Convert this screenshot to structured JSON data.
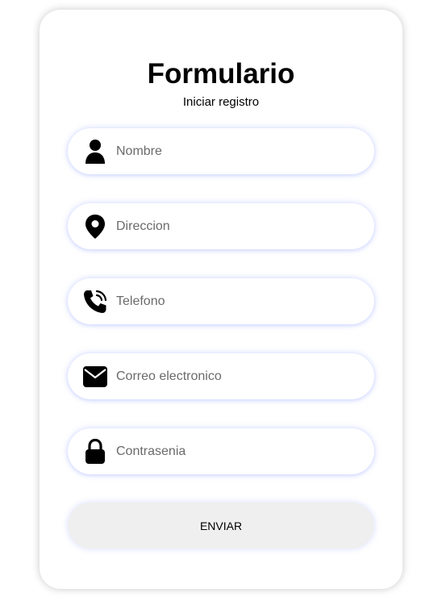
{
  "form": {
    "title": "Formulario",
    "subtitle": "Iniciar registro",
    "fields": [
      {
        "icon": "user-icon",
        "placeholder": "Nombre",
        "value": ""
      },
      {
        "icon": "location-pin-icon",
        "placeholder": "Direccion",
        "value": ""
      },
      {
        "icon": "phone-icon",
        "placeholder": "Telefono",
        "value": ""
      },
      {
        "icon": "envelope-icon",
        "placeholder": "Correo electronico",
        "value": ""
      },
      {
        "icon": "lock-icon",
        "placeholder": "Contrasenia",
        "value": ""
      }
    ],
    "submit_label": "ENVIAR"
  },
  "colors": {
    "card_background": "#ffffff",
    "field_glow": "#788cff",
    "button_background": "#efefef",
    "text": "#000000"
  }
}
